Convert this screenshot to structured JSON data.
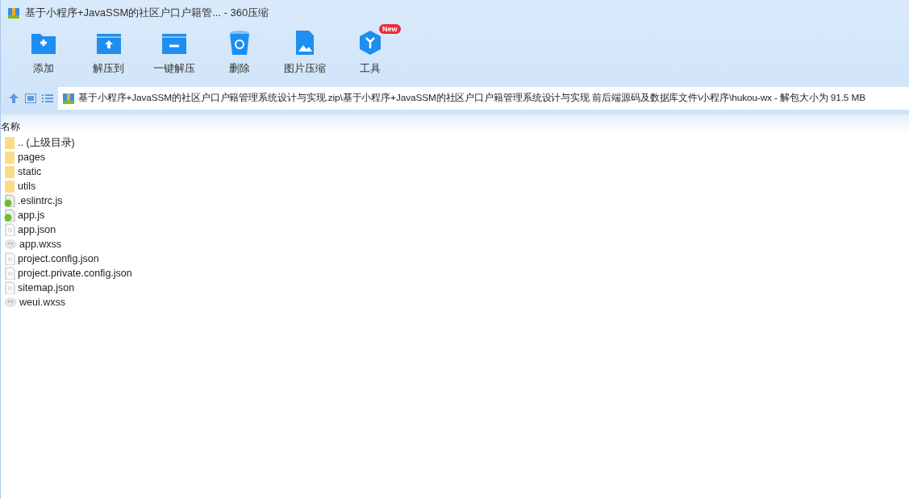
{
  "window": {
    "title": "基于小程序+JavaSSM的社区户口户籍管... - 360压缩"
  },
  "toolbar": [
    {
      "kind": "add",
      "label": "添加"
    },
    {
      "kind": "extract",
      "label": "解压到"
    },
    {
      "kind": "oneclick",
      "label": "一键解压"
    },
    {
      "kind": "delete",
      "label": "删除"
    },
    {
      "kind": "image",
      "label": "图片压缩"
    },
    {
      "kind": "tools",
      "label": "工具",
      "badge": "New"
    }
  ],
  "address": {
    "path": "基于小程序+JavaSSM的社区户口户籍管理系统设计与实现.zip\\基于小程序+JavaSSM的社区户口户籍管理系统设计与实现 前后端源码及数据库文件\\小程序\\hukou-wx - 解包大小为 91.5 MB"
  },
  "list": {
    "columns": [
      "名称"
    ],
    "files": [
      {
        "kind": "folder",
        "name": ".. (上级目录)"
      },
      {
        "kind": "folder",
        "name": "pages"
      },
      {
        "kind": "folder",
        "name": "static"
      },
      {
        "kind": "folder",
        "name": "utils"
      },
      {
        "kind": "js",
        "name": ".eslintrc.js"
      },
      {
        "kind": "js",
        "name": "app.js"
      },
      {
        "kind": "json",
        "name": "app.json"
      },
      {
        "kind": "wxss",
        "name": "app.wxss"
      },
      {
        "kind": "json",
        "name": "project.config.json"
      },
      {
        "kind": "json",
        "name": "project.private.config.json"
      },
      {
        "kind": "json",
        "name": "sitemap.json"
      },
      {
        "kind": "wxss",
        "name": "weui.wxss"
      }
    ]
  }
}
